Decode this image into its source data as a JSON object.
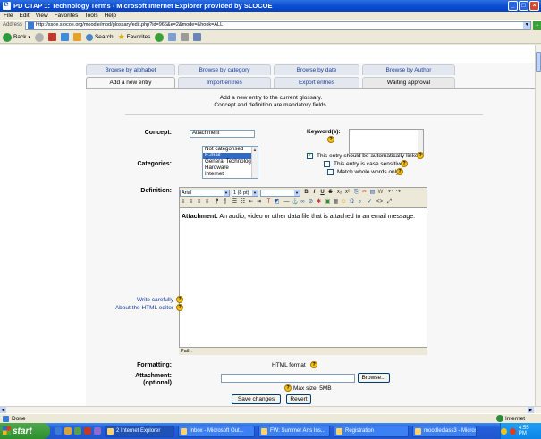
{
  "window": {
    "title": "PD CTAP 1: Technology Terms - Microsoft Internet Explorer provided by SLOCOE"
  },
  "menu": [
    "File",
    "Edit",
    "View",
    "Favorites",
    "Tools",
    "Help"
  ],
  "address": {
    "label": "Address",
    "url": "http://ssoe.slocoe.org/moodle/mod/glossary/edit.php?id=966&e=2&mode=&hook=ALL",
    "go_label": "Go"
  },
  "toolbar": {
    "back": "Back",
    "search": "Search",
    "favorites": "Favorites"
  },
  "tabs_row1": [
    "Browse by alphabet",
    "Browse by category",
    "Browse by date",
    "Browse by Author"
  ],
  "tabs_row2": [
    "Add a new entry",
    "Import entries",
    "Export entries",
    "Waiting approval"
  ],
  "intro": {
    "line1": "Add a new entry to the current glossary.",
    "line2": "Concept and definition are mandatory fields."
  },
  "form": {
    "concept_label": "Concept:",
    "concept_value": "Attachment",
    "keywords_label": "Keyword(s):",
    "categories_label": "Categories:",
    "categories": [
      "Not categorised",
      "E-mail",
      "General Technology",
      "Hardware",
      "Internet"
    ],
    "selected_category": "E-mail",
    "checkbox_autolink": "This entry should be automatically linked",
    "checkbox_case": "This entry is case sensitive",
    "checkbox_whole": "Match whole words only",
    "definition_label": "Definition:",
    "editor_font": "Arial",
    "editor_size": "1 (8 pt)",
    "definition_term": "Attachment:",
    "definition_text": " An audio, video or other data file that is attached to an email message.",
    "editor_path": "Path:",
    "write_carefully": "Write carefully",
    "about_editor": "About the HTML editor",
    "formatting_label": "Formatting:",
    "formatting_value": "HTML format",
    "attachment_label": "Attachment:",
    "attachment_optional": "(optional)",
    "browse_button": "Browse...",
    "max_size": "Max size: 5MB",
    "save_button": "Save changes",
    "revert_button": "Revert"
  },
  "status": {
    "left": "Done",
    "zone": "Internet"
  },
  "taskbar": {
    "start": "start",
    "tasks": [
      "2 Internet Explorer",
      "Inbox - Microsoft Out...",
      "FW: Summer Arts Ins...",
      "Registration",
      "moodleclass3 - Micros..."
    ],
    "clock": "4:55 PM"
  },
  "colors": {
    "tab_link": "#1a3e96",
    "selection": "#316ac5",
    "help_icon": "#f4c21b",
    "titlebar": "#0a4fd4"
  }
}
